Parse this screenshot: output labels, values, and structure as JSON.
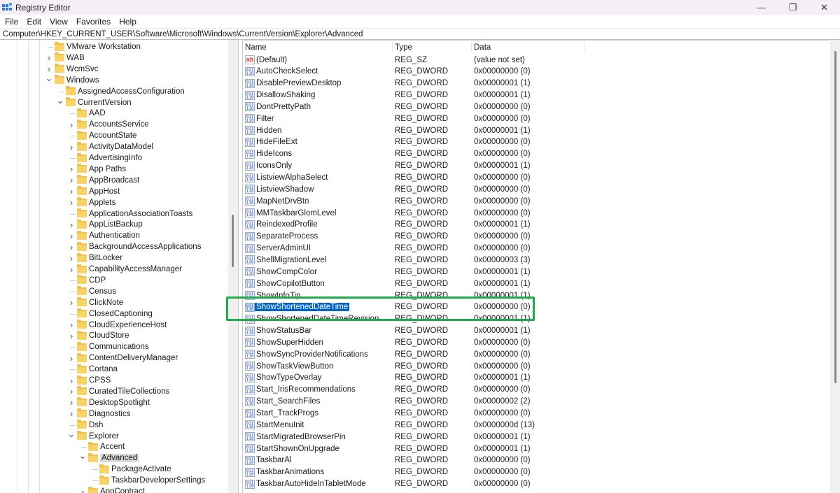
{
  "window": {
    "title": "Registry Editor",
    "controls": {
      "minimize": "—",
      "restore": "❐",
      "close": "✕"
    }
  },
  "menu": [
    "File",
    "Edit",
    "View",
    "Favorites",
    "Help"
  ],
  "address": "Computer\\HKEY_CURRENT_USER\\Software\\Microsoft\\Windows\\CurrentVersion\\Explorer\\Advanced",
  "tree": [
    {
      "label": "VMware Workstation",
      "level": 0,
      "expander": "none"
    },
    {
      "label": "WAB",
      "level": 0,
      "expander": "collapsed"
    },
    {
      "label": "WcmSvc",
      "level": 0,
      "expander": "collapsed"
    },
    {
      "label": "Windows",
      "level": 0,
      "expander": "expanded"
    },
    {
      "label": "AssignedAccessConfiguration",
      "level": 1,
      "expander": "none"
    },
    {
      "label": "CurrentVersion",
      "level": 1,
      "expander": "expanded"
    },
    {
      "label": "AAD",
      "level": 2,
      "expander": "none"
    },
    {
      "label": "AccountsService",
      "level": 2,
      "expander": "collapsed"
    },
    {
      "label": "AccountState",
      "level": 2,
      "expander": "none"
    },
    {
      "label": "ActivityDataModel",
      "level": 2,
      "expander": "collapsed"
    },
    {
      "label": "AdvertisingInfo",
      "level": 2,
      "expander": "none"
    },
    {
      "label": "App Paths",
      "level": 2,
      "expander": "collapsed"
    },
    {
      "label": "AppBroadcast",
      "level": 2,
      "expander": "collapsed"
    },
    {
      "label": "AppHost",
      "level": 2,
      "expander": "collapsed"
    },
    {
      "label": "Applets",
      "level": 2,
      "expander": "collapsed"
    },
    {
      "label": "ApplicationAssociationToasts",
      "level": 2,
      "expander": "none"
    },
    {
      "label": "AppListBackup",
      "level": 2,
      "expander": "collapsed"
    },
    {
      "label": "Authentication",
      "level": 2,
      "expander": "collapsed"
    },
    {
      "label": "BackgroundAccessApplications",
      "level": 2,
      "expander": "collapsed"
    },
    {
      "label": "BitLocker",
      "level": 2,
      "expander": "collapsed"
    },
    {
      "label": "CapabilityAccessManager",
      "level": 2,
      "expander": "collapsed"
    },
    {
      "label": "CDP",
      "level": 2,
      "expander": "none"
    },
    {
      "label": "Census",
      "level": 2,
      "expander": "none"
    },
    {
      "label": "ClickNote",
      "level": 2,
      "expander": "collapsed"
    },
    {
      "label": "ClosedCaptioning",
      "level": 2,
      "expander": "none"
    },
    {
      "label": "CloudExperienceHost",
      "level": 2,
      "expander": "collapsed"
    },
    {
      "label": "CloudStore",
      "level": 2,
      "expander": "collapsed"
    },
    {
      "label": "Communications",
      "level": 2,
      "expander": "none"
    },
    {
      "label": "ContentDeliveryManager",
      "level": 2,
      "expander": "collapsed"
    },
    {
      "label": "Cortana",
      "level": 2,
      "expander": "none"
    },
    {
      "label": "CPSS",
      "level": 2,
      "expander": "collapsed"
    },
    {
      "label": "CuratedTileCollections",
      "level": 2,
      "expander": "collapsed"
    },
    {
      "label": "DesktopSpotlight",
      "level": 2,
      "expander": "collapsed"
    },
    {
      "label": "Diagnostics",
      "level": 2,
      "expander": "collapsed"
    },
    {
      "label": "Dsh",
      "level": 2,
      "expander": "none"
    },
    {
      "label": "Explorer",
      "level": 2,
      "expander": "expanded"
    },
    {
      "label": "Accent",
      "level": 3,
      "expander": "none"
    },
    {
      "label": "Advanced",
      "level": 3,
      "expander": "expanded",
      "selected": true
    },
    {
      "label": "PackageActivate",
      "level": 4,
      "expander": "none"
    },
    {
      "label": "TaskbarDeveloperSettings",
      "level": 4,
      "expander": "none"
    },
    {
      "label": "AppContract",
      "level": 3,
      "expander": "collapsed"
    }
  ],
  "list": {
    "columns": {
      "name": "Name",
      "type": "Type",
      "data": "Data"
    },
    "rows": [
      {
        "name": "(Default)",
        "type": "REG_SZ",
        "data": "(value not set)",
        "icon": "string-value-icon"
      },
      {
        "name": "AutoCheckSelect",
        "type": "REG_DWORD",
        "data": "0x00000000 (0)",
        "icon": "dword-value-icon"
      },
      {
        "name": "DisablePreviewDesktop",
        "type": "REG_DWORD",
        "data": "0x00000001 (1)",
        "icon": "dword-value-icon"
      },
      {
        "name": "DisallowShaking",
        "type": "REG_DWORD",
        "data": "0x00000001 (1)",
        "icon": "dword-value-icon"
      },
      {
        "name": "DontPrettyPath",
        "type": "REG_DWORD",
        "data": "0x00000000 (0)",
        "icon": "dword-value-icon"
      },
      {
        "name": "Filter",
        "type": "REG_DWORD",
        "data": "0x00000000 (0)",
        "icon": "dword-value-icon"
      },
      {
        "name": "Hidden",
        "type": "REG_DWORD",
        "data": "0x00000001 (1)",
        "icon": "dword-value-icon"
      },
      {
        "name": "HideFileExt",
        "type": "REG_DWORD",
        "data": "0x00000000 (0)",
        "icon": "dword-value-icon"
      },
      {
        "name": "HideIcons",
        "type": "REG_DWORD",
        "data": "0x00000000 (0)",
        "icon": "dword-value-icon"
      },
      {
        "name": "IconsOnly",
        "type": "REG_DWORD",
        "data": "0x00000001 (1)",
        "icon": "dword-value-icon"
      },
      {
        "name": "ListviewAlphaSelect",
        "type": "REG_DWORD",
        "data": "0x00000000 (0)",
        "icon": "dword-value-icon"
      },
      {
        "name": "ListviewShadow",
        "type": "REG_DWORD",
        "data": "0x00000000 (0)",
        "icon": "dword-value-icon"
      },
      {
        "name": "MapNetDrvBtn",
        "type": "REG_DWORD",
        "data": "0x00000000 (0)",
        "icon": "dword-value-icon"
      },
      {
        "name": "MMTaskbarGlomLevel",
        "type": "REG_DWORD",
        "data": "0x00000000 (0)",
        "icon": "dword-value-icon"
      },
      {
        "name": "ReindexedProfile",
        "type": "REG_DWORD",
        "data": "0x00000001 (1)",
        "icon": "dword-value-icon"
      },
      {
        "name": "SeparateProcess",
        "type": "REG_DWORD",
        "data": "0x00000000 (0)",
        "icon": "dword-value-icon"
      },
      {
        "name": "ServerAdminUI",
        "type": "REG_DWORD",
        "data": "0x00000000 (0)",
        "icon": "dword-value-icon"
      },
      {
        "name": "ShellMigrationLevel",
        "type": "REG_DWORD",
        "data": "0x00000003 (3)",
        "icon": "dword-value-icon"
      },
      {
        "name": "ShowCompColor",
        "type": "REG_DWORD",
        "data": "0x00000001 (1)",
        "icon": "dword-value-icon"
      },
      {
        "name": "ShowCopilotButton",
        "type": "REG_DWORD",
        "data": "0x00000001 (1)",
        "icon": "dword-value-icon"
      },
      {
        "name": "ShowInfoTip",
        "type": "REG_DWORD",
        "data": "0x00000001 (1)",
        "icon": "dword-value-icon"
      },
      {
        "name": "ShowShortenedDateTime",
        "type": "REG_DWORD",
        "data": "0x00000000 (0)",
        "icon": "dword-value-icon",
        "selected": true
      },
      {
        "name": "ShowShortenedDateTimeRevision",
        "type": "REG_DWORD",
        "data": "0x00000001 (1)",
        "icon": "dword-value-icon"
      },
      {
        "name": "ShowStatusBar",
        "type": "REG_DWORD",
        "data": "0x00000001 (1)",
        "icon": "dword-value-icon"
      },
      {
        "name": "ShowSuperHidden",
        "type": "REG_DWORD",
        "data": "0x00000000 (0)",
        "icon": "dword-value-icon"
      },
      {
        "name": "ShowSyncProviderNotifications",
        "type": "REG_DWORD",
        "data": "0x00000000 (0)",
        "icon": "dword-value-icon"
      },
      {
        "name": "ShowTaskViewButton",
        "type": "REG_DWORD",
        "data": "0x00000000 (0)",
        "icon": "dword-value-icon"
      },
      {
        "name": "ShowTypeOverlay",
        "type": "REG_DWORD",
        "data": "0x00000001 (1)",
        "icon": "dword-value-icon"
      },
      {
        "name": "Start_IrisRecommendations",
        "type": "REG_DWORD",
        "data": "0x00000000 (0)",
        "icon": "dword-value-icon"
      },
      {
        "name": "Start_SearchFiles",
        "type": "REG_DWORD",
        "data": "0x00000002 (2)",
        "icon": "dword-value-icon"
      },
      {
        "name": "Start_TrackProgs",
        "type": "REG_DWORD",
        "data": "0x00000000 (0)",
        "icon": "dword-value-icon"
      },
      {
        "name": "StartMenuInit",
        "type": "REG_DWORD",
        "data": "0x0000000d (13)",
        "icon": "dword-value-icon"
      },
      {
        "name": "StartMigratedBrowserPin",
        "type": "REG_DWORD",
        "data": "0x00000001 (1)",
        "icon": "dword-value-icon"
      },
      {
        "name": "StartShownOnUpgrade",
        "type": "REG_DWORD",
        "data": "0x00000001 (1)",
        "icon": "dword-value-icon"
      },
      {
        "name": "TaskbarAl",
        "type": "REG_DWORD",
        "data": "0x00000000 (0)",
        "icon": "dword-value-icon"
      },
      {
        "name": "TaskbarAnimations",
        "type": "REG_DWORD",
        "data": "0x00000000 (0)",
        "icon": "dword-value-icon"
      },
      {
        "name": "TaskbarAutoHideInTabletMode",
        "type": "REG_DWORD",
        "data": "0x00000000 (0)",
        "icon": "dword-value-icon"
      }
    ]
  },
  "annotation": {
    "color": "#22a94a",
    "target": "ShowShortenedDateTime"
  },
  "icons": {
    "dword_glyph": "011\n110",
    "sz_glyph": "ab"
  }
}
